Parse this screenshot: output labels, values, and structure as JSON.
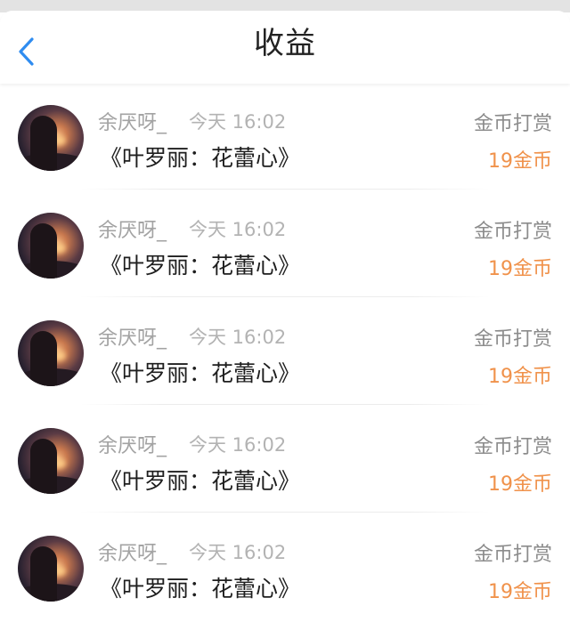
{
  "header": {
    "title": "收益",
    "back_icon": "chevron-left-icon"
  },
  "colors": {
    "accent_blue": "#2f8cf0",
    "amount_orange": "#f0924b",
    "title_text": "#222222"
  },
  "records": [
    {
      "user": "余厌呀_",
      "time": "今天 16:02",
      "book": "《叶罗丽：花蕾心》",
      "type": "金币打赏",
      "amount": "19金币"
    },
    {
      "user": "余厌呀_",
      "time": "今天 16:02",
      "book": "《叶罗丽：花蕾心》",
      "type": "金币打赏",
      "amount": "19金币"
    },
    {
      "user": "余厌呀_",
      "time": "今天 16:02",
      "book": "《叶罗丽：花蕾心》",
      "type": "金币打赏",
      "amount": "19金币"
    },
    {
      "user": "余厌呀_",
      "time": "今天 16:02",
      "book": "《叶罗丽：花蕾心》",
      "type": "金币打赏",
      "amount": "19金币"
    },
    {
      "user": "余厌呀_",
      "time": "今天 16:02",
      "book": "《叶罗丽：花蕾心》",
      "type": "金币打赏",
      "amount": "19金币"
    }
  ]
}
